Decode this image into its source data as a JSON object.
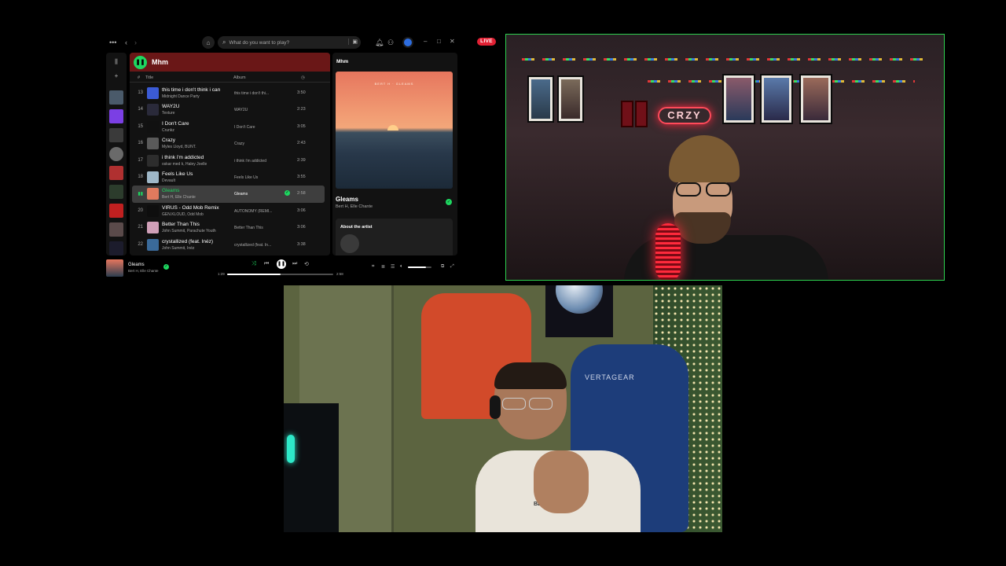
{
  "live_badge": "LIVE",
  "spotify": {
    "search_placeholder": "What do you want to play?",
    "playlist": {
      "title": "Mhm",
      "columns": {
        "num": "#",
        "title": "Title",
        "album": "Album"
      },
      "tracks": [
        {
          "num": "13",
          "title": "this time i don't think i can",
          "artist": "Midnight Dance Party",
          "album": "this time i don't thi...",
          "duration": "3:50",
          "active": false,
          "art": "#3b5bd6"
        },
        {
          "num": "14",
          "title": "WAY2U",
          "artist": "Texture",
          "album": "WAY2U",
          "duration": "2:23",
          "active": false,
          "art": "#2a2a3a"
        },
        {
          "num": "15",
          "title": "I Don't Care",
          "artist": "Crunkz",
          "album": "I Don't Care",
          "duration": "3:05",
          "active": false,
          "art": "#111111"
        },
        {
          "num": "16",
          "title": "Crazy",
          "artist": "Myles Lloyd, BUNT.",
          "album": "Crazy",
          "duration": "2:43",
          "active": false,
          "art": "#5a5a5a"
        },
        {
          "num": "17",
          "title": "i think i'm addicted",
          "artist": "oskar med k, Haley Joelle",
          "album": "i think i'm addicted",
          "duration": "2:39",
          "active": false,
          "art": "#2d2d2d"
        },
        {
          "num": "18",
          "title": "Feels Like Us",
          "artist": "Devault",
          "album": "Feels Like Us",
          "duration": "3:55",
          "active": false,
          "art": "#9fb8c8"
        },
        {
          "num": "",
          "title": "Gleams",
          "artist": "Bert H, Elle Chante",
          "album": "Gleams",
          "duration": "2:58",
          "active": true,
          "art": "#e07a5e"
        },
        {
          "num": "20",
          "title": "VIRUS - Odd Mob Remix",
          "artist": "GEN.KLOUD, Odd Mob",
          "album": "AUTONOMY (REMI...",
          "duration": "3:06",
          "active": false,
          "art": "#0e0e0e"
        },
        {
          "num": "21",
          "title": "Better Than This",
          "artist": "John Summit, Parachute Youth",
          "album": "Better Than This",
          "duration": "3:06",
          "active": false,
          "art": "#d0a0b8"
        },
        {
          "num": "22",
          "title": "crystallized (feat. Inéz)",
          "artist": "John Summit, Inéz",
          "album": "crystallized (feat. In...",
          "duration": "3:38",
          "active": false,
          "art": "#3a6a9a"
        }
      ]
    },
    "now_playing_panel": {
      "playlist_name": "Mhm",
      "cover_text": "BERT H  ·  GLEAMS",
      "song": "Gleams",
      "artist": "Bert H, Elle Chante",
      "about_title": "About the artist"
    },
    "player": {
      "song": "Gleams",
      "artist": "Bert H, Elle Chante",
      "current_time": "1:29",
      "total_time": "2:58",
      "progress": 0.5,
      "volume": 0.75
    }
  },
  "webcam_top": {
    "sign_text": "CRZY"
  },
  "webcam_bottom": {
    "chair_text": "VERTAGEAR",
    "shirt_text": "BERT CITY"
  },
  "colors": {
    "spotify_green": "#1ed760",
    "live_red": "#e22134",
    "cam_border": "#2ed14f",
    "header_red": "#6a1717"
  }
}
